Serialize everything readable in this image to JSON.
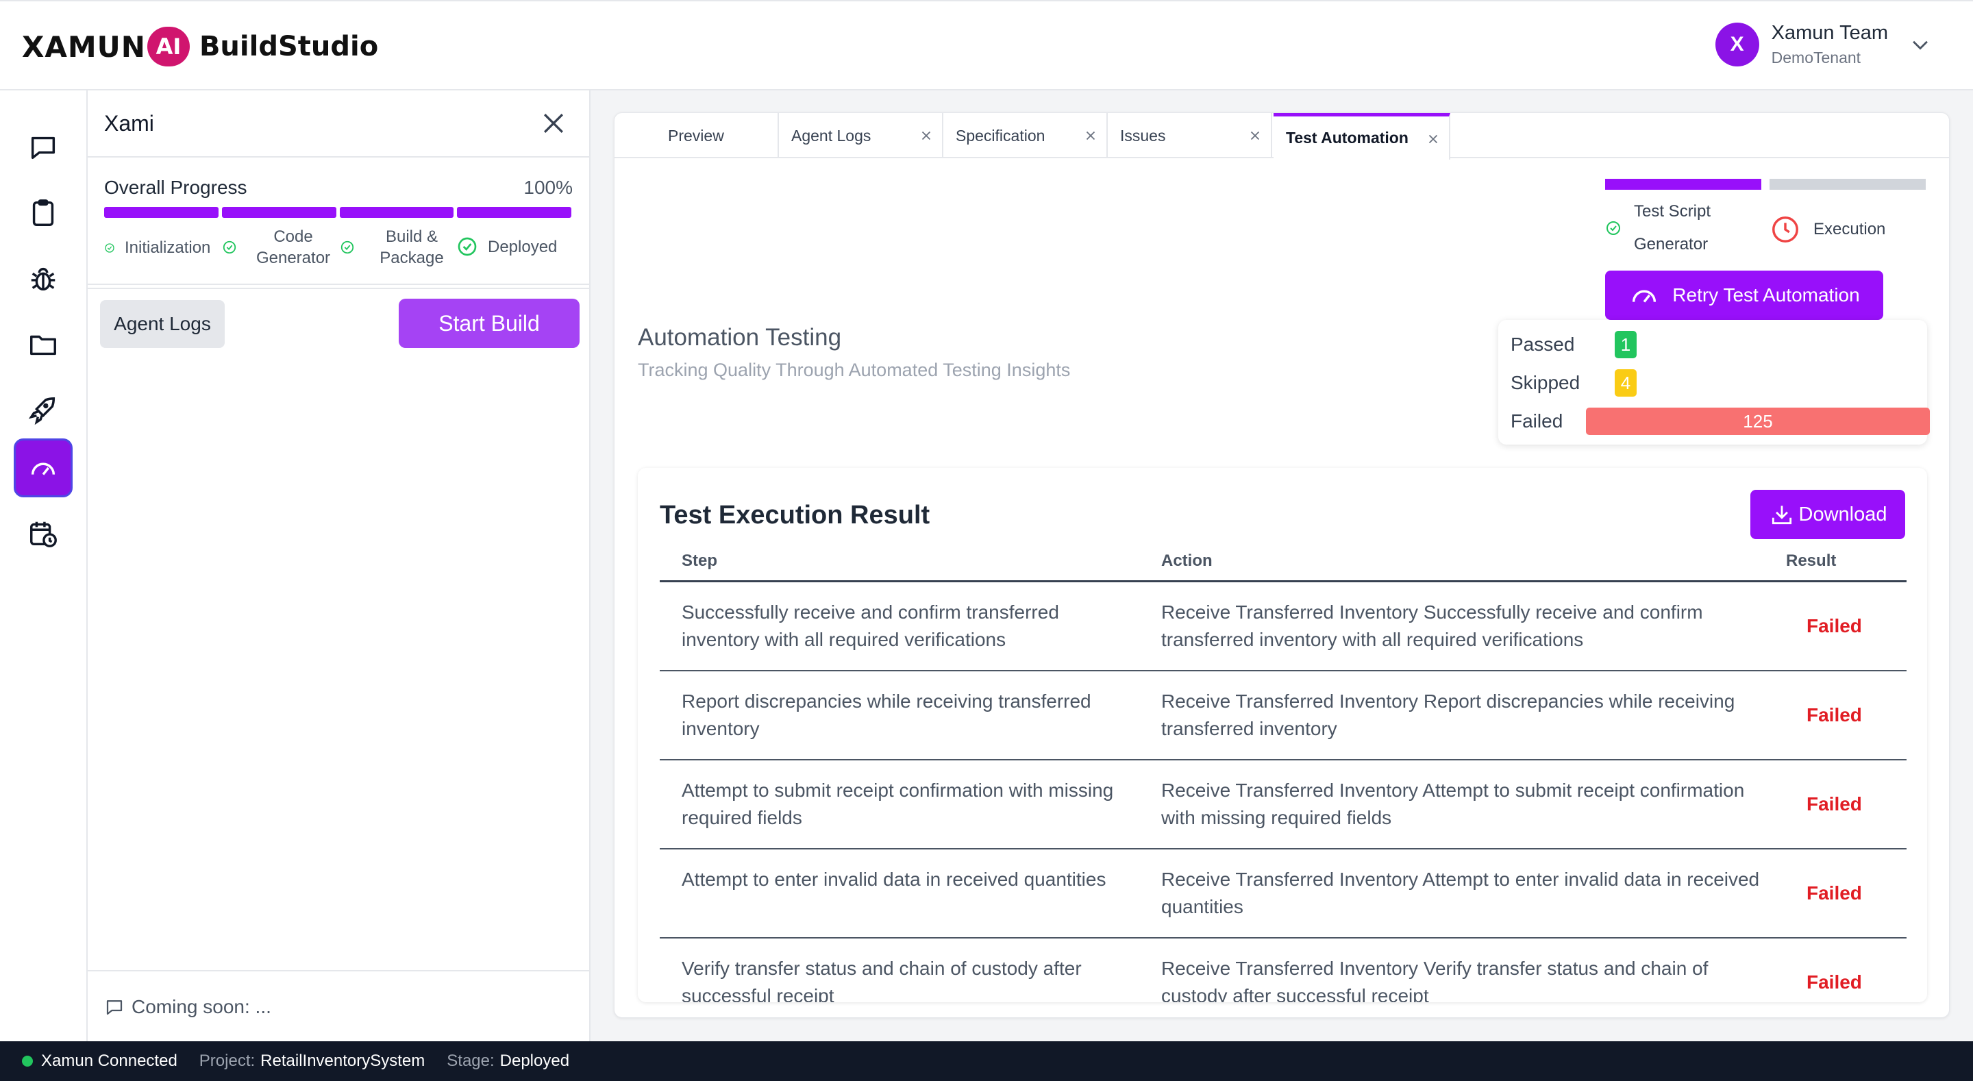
{
  "header": {
    "logo_text": "XAMUN",
    "logo_ai": "AI",
    "logo_product": "BuildStudio",
    "user_initial": "X",
    "user_name": "Xamun Team",
    "user_tenant": "DemoTenant",
    "chevron_icon": "chevron-down-icon"
  },
  "rail": {
    "items": [
      {
        "icon": "chat-icon",
        "active": false
      },
      {
        "icon": "clipboard-icon",
        "active": false
      },
      {
        "icon": "bug-icon",
        "active": false
      },
      {
        "icon": "folder-icon",
        "active": false
      },
      {
        "icon": "rocket-icon",
        "active": false
      },
      {
        "icon": "gauge-icon",
        "active": true
      },
      {
        "icon": "calendar-clock-icon",
        "active": false
      }
    ]
  },
  "panel": {
    "title": "Xami",
    "progress_title": "Overall Progress",
    "progress_percent": "100%",
    "progress_value": 1.0,
    "segments_completed": 4,
    "stages": [
      {
        "label": "Initialization",
        "done": true
      },
      {
        "label": "Code Generator",
        "done": true
      },
      {
        "label": "Build & Package",
        "done": true
      },
      {
        "label": "Deployed",
        "done": true
      }
    ],
    "agent_logs_label": "Agent Logs",
    "start_build_label": "Start Build",
    "footer_text": "Coming soon: ..."
  },
  "tabs": [
    {
      "label": "Preview",
      "closable": false,
      "active": false
    },
    {
      "label": "Agent Logs",
      "closable": true,
      "active": false
    },
    {
      "label": "Specification",
      "closable": true,
      "active": false
    },
    {
      "label": "Issues",
      "closable": true,
      "active": false
    },
    {
      "label": "Test Automation",
      "closable": true,
      "active": true
    }
  ],
  "stepper": {
    "step1_label": "Test Script Generator",
    "step1_status": "done",
    "step2_label": "Execution",
    "step2_status": "pending"
  },
  "retry_label": "Retry Test Automation",
  "automation": {
    "title": "Automation Testing",
    "subtitle": "Tracking Quality Through Automated Testing Insights"
  },
  "summary": {
    "passed_label": "Passed",
    "passed_value": "1",
    "skipped_label": "Skipped",
    "skipped_value": "4",
    "failed_label": "Failed",
    "failed_value": "125",
    "colors": {
      "passed": "#22c55e",
      "skipped": "#facc15",
      "failed": "#f87171"
    }
  },
  "results": {
    "title": "Test Execution Result",
    "download_label": "Download",
    "headers": {
      "step": "Step",
      "action": "Action",
      "result": "Result"
    },
    "rows": [
      {
        "step": "Successfully receive and confirm transferred inventory with all required verifications",
        "action": "Receive Transferred Inventory Successfully receive and confirm transferred inventory with all required verifications",
        "result": "Failed"
      },
      {
        "step": "Report discrepancies while receiving transferred inventory",
        "action": "Receive Transferred Inventory Report discrepancies while receiving transferred inventory",
        "result": "Failed"
      },
      {
        "step": "Attempt to submit receipt confirmation with missing required fields",
        "action": "Receive Transferred Inventory Attempt to submit receipt confirmation with missing required fields",
        "result": "Failed"
      },
      {
        "step": "Attempt to enter invalid data in received quantities",
        "action": "Receive Transferred Inventory Attempt to enter invalid data in received quantities",
        "result": "Failed"
      },
      {
        "step": "Verify transfer status and chain of custody after successful receipt",
        "action": "Receive Transferred Inventory Verify transfer status and chain of custody after successful receipt",
        "result": "Failed"
      }
    ]
  },
  "statusbar": {
    "connection": "Xamun Connected",
    "project_label": "Project:",
    "project_value": "RetailInventorySystem",
    "stage_label": "Stage:",
    "stage_value": "Deployed"
  },
  "colors": {
    "accent": "#9810fa",
    "danger": "#e11d24",
    "success": "#22c55e"
  }
}
